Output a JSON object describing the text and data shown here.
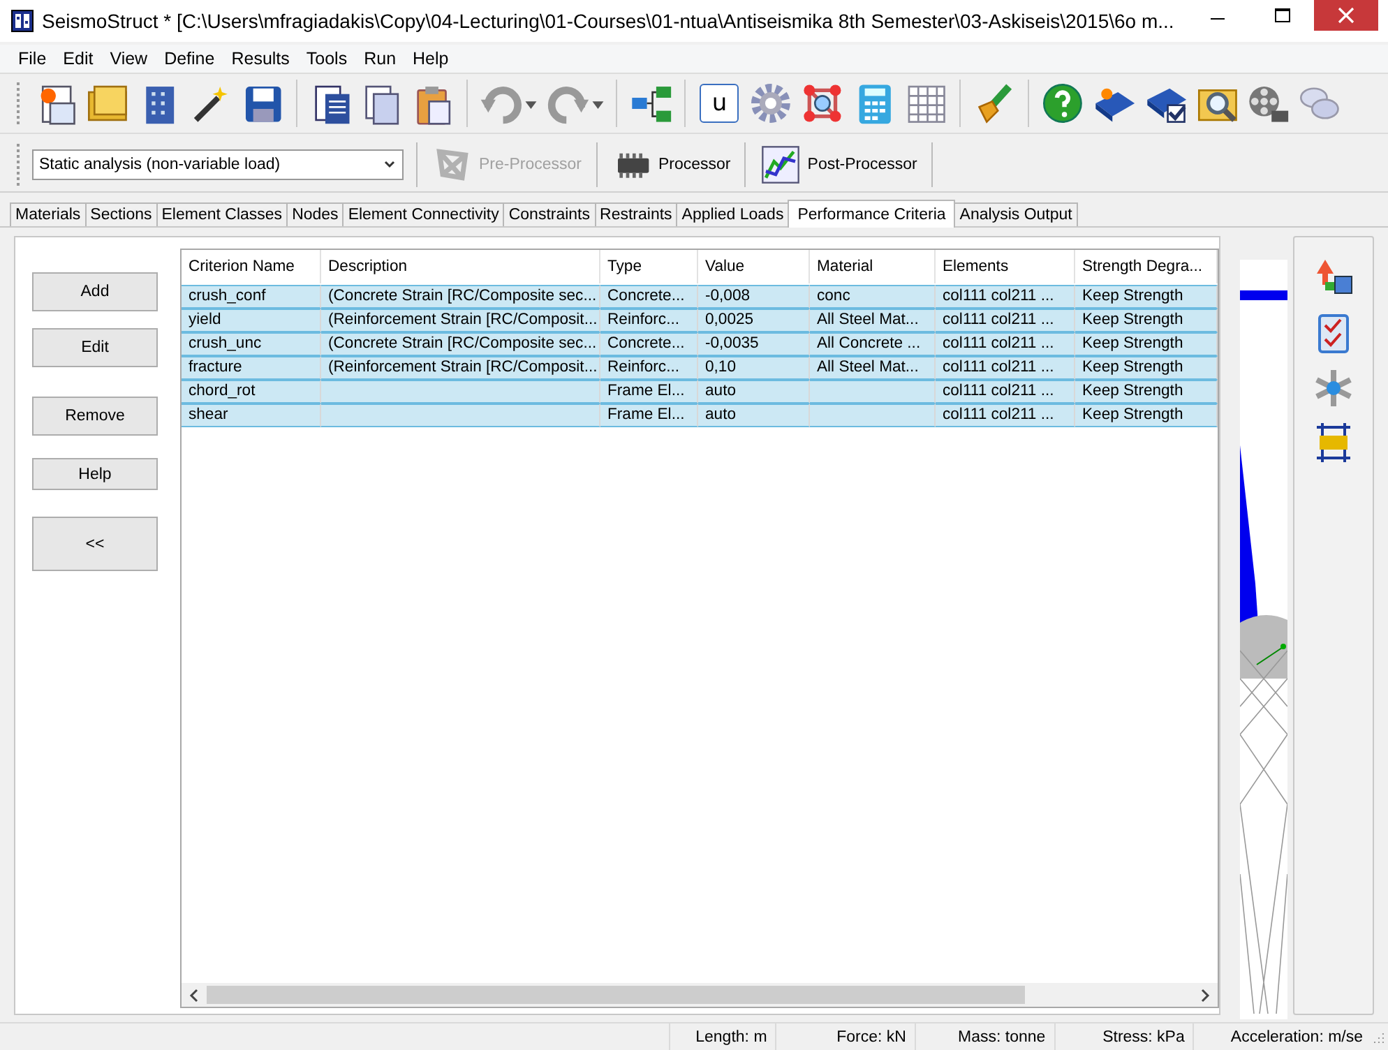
{
  "window": {
    "title": "SeismoStruct * [C:\\Users\\mfragiadakis\\Copy\\04-Lecturing\\01-Courses\\01-ntua\\Antiseismika 8th Semester\\03-Askiseis\\2015\\6o m..."
  },
  "menu": [
    "File",
    "Edit",
    "View",
    "Define",
    "Results",
    "Tools",
    "Run",
    "Help"
  ],
  "toolbar": {
    "unit_button": "u"
  },
  "analysis_bar": {
    "analysis_type": "Static analysis (non-variable load)",
    "modules": [
      {
        "label": "Pre-Processor",
        "disabled": true
      },
      {
        "label": "Processor",
        "disabled": false
      },
      {
        "label": "Post-Processor",
        "disabled": false
      }
    ]
  },
  "tabs": [
    {
      "label": "Materials",
      "selected": false
    },
    {
      "label": "Sections",
      "selected": false
    },
    {
      "label": "Element Classes",
      "selected": false
    },
    {
      "label": "Nodes",
      "selected": false
    },
    {
      "label": "Element Connectivity",
      "selected": false
    },
    {
      "label": "Constraints",
      "selected": false
    },
    {
      "label": "Restraints",
      "selected": false
    },
    {
      "label": "Applied Loads",
      "selected": false
    },
    {
      "label": "Performance Criteria",
      "selected": true
    },
    {
      "label": "Analysis Output",
      "selected": false
    }
  ],
  "side_buttons": [
    "Add",
    "Edit",
    "Remove",
    "Help",
    "<<"
  ],
  "table": {
    "columns": [
      "Criterion Name",
      "Description",
      "Type",
      "Value",
      "Material",
      "Elements",
      "Strength Degra..."
    ],
    "rows": [
      {
        "selected": true,
        "cells": [
          "crush_conf",
          "(Concrete Strain [RC/Composite sec...",
          "Concrete...",
          "-0,008",
          "conc",
          "col111   col211 ...",
          "Keep Strength"
        ]
      },
      {
        "selected": true,
        "cells": [
          "yield",
          "(Reinforcement Strain [RC/Composit...",
          "Reinforc...",
          "0,0025",
          "All Steel Mat...",
          "col111   col211 ...",
          "Keep Strength"
        ]
      },
      {
        "selected": true,
        "cells": [
          "crush_unc",
          "(Concrete Strain [RC/Composite sec...",
          "Concrete...",
          "-0,0035",
          "All Concrete ...",
          "col111   col211 ...",
          "Keep Strength"
        ]
      },
      {
        "selected": true,
        "cells": [
          "fracture",
          "(Reinforcement Strain [RC/Composit...",
          "Reinforc...",
          "0,10",
          "All Steel Mat...",
          "col111   col211 ...",
          "Keep Strength"
        ]
      },
      {
        "selected": true,
        "cells": [
          "chord_rot",
          "",
          "Frame El...",
          "auto",
          "",
          "col111   col211 ...",
          "Keep Strength"
        ]
      },
      {
        "selected": true,
        "cells": [
          "shear",
          "",
          "Frame El...",
          "auto",
          "",
          "col111   col211 ...",
          "Keep Strength"
        ]
      }
    ]
  },
  "status_bar": [
    "Length: m",
    "Force: kN",
    "Mass: tonne",
    "Stress: kPa",
    "Acceleration: m/se"
  ]
}
